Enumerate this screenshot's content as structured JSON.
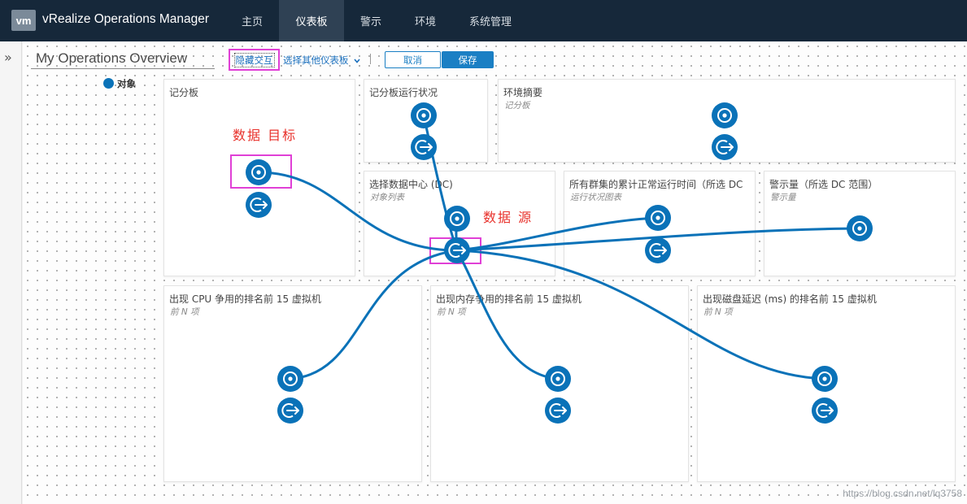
{
  "app": {
    "logo": "vm",
    "title": "vRealize Operations Manager"
  },
  "nav": [
    {
      "label": "主页"
    },
    {
      "label": "仪表板"
    },
    {
      "label": "警示"
    },
    {
      "label": "环境"
    },
    {
      "label": "系统管理"
    }
  ],
  "sidebar": {
    "expand_glyph": "»"
  },
  "toolbar": {
    "dashboard_name": "My Operations Overview",
    "hide_interaction": "隐藏交互",
    "select_other": "选择其他仪表板",
    "cancel": "取消",
    "save": "保存"
  },
  "legend": {
    "label": "对象",
    "color": "#0a72b8"
  },
  "widgets": [
    {
      "title": "记分板",
      "subtitle": ""
    },
    {
      "title": "记分板运行状况",
      "subtitle": ""
    },
    {
      "title": "环境摘要",
      "subtitle": "记分板"
    },
    {
      "title": "选择数据中心 (DC)",
      "subtitle": "对象列表"
    },
    {
      "title": "所有群集的累计正常运行时间（所选 DC",
      "subtitle": "运行状况图表"
    },
    {
      "title": "警示量（所选 DC 范围）",
      "subtitle": "警示量"
    },
    {
      "title": "出现 CPU 争用的排名前 15 虚拟机",
      "subtitle": "前 N 项"
    },
    {
      "title": "出现内存争用的排名前 15 虚拟机",
      "subtitle": "前 N 项"
    },
    {
      "title": "出现磁盘延迟 (ms) 的排名前 15 虚拟机",
      "subtitle": "前 N 项"
    }
  ],
  "annotations": {
    "target": "数据  目标",
    "source": "数据  源"
  },
  "watermark": "https://blog.csdn.net/lq3758",
  "colors": {
    "header_bg": "#16283a",
    "active_tab": "#2f4154",
    "link_blue": "#1a6fbd",
    "button_blue": "#1a7fc4",
    "node_blue": "#0a72b8",
    "highlight": "#e040d6",
    "annotation_red": "#e8312b"
  },
  "icons": {
    "receive": "target-circle-icon",
    "send": "arrow-out-circle-icon"
  }
}
